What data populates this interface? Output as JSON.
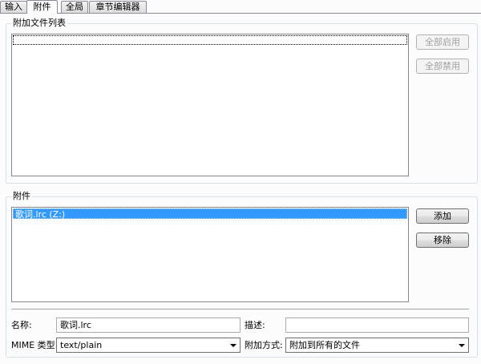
{
  "tabs": [
    {
      "label": "输入",
      "active": false
    },
    {
      "label": "附件",
      "active": true
    },
    {
      "label": "全局",
      "active": false
    },
    {
      "label": "章节编辑器",
      "active": false
    }
  ],
  "attached_files_group": {
    "title": "附加文件列表",
    "items": [],
    "enable_all_label": "全部启用",
    "disable_all_label": "全部禁用"
  },
  "attachments_group": {
    "title": "附件",
    "items": [
      {
        "label": "歌词.lrc (Z:)",
        "selected": true
      }
    ],
    "add_label": "添加",
    "remove_label": "移除",
    "name_label": "名称:",
    "name_value": "歌词.lrc",
    "description_label": "描述:",
    "description_value": "",
    "mime_label": "MIME 类型:",
    "mime_value": "text/plain",
    "attach_mode_label": "附加方式:",
    "attach_mode_value": "附加到所有的文件"
  },
  "colors": {
    "selection": "#3399ff",
    "group_border": "#d5dfe5",
    "disabled_text": "#a0a0a0"
  }
}
